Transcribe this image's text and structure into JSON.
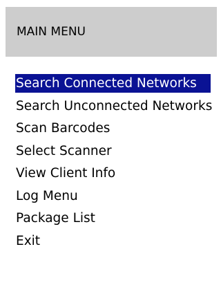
{
  "header": {
    "title": "MAIN MENU"
  },
  "menu": {
    "selected_index": 0,
    "items": [
      {
        "label": "Search Connected Networks"
      },
      {
        "label": "Search Unconnected Networks"
      },
      {
        "label": "Scan Barcodes"
      },
      {
        "label": "Select Scanner"
      },
      {
        "label": "View Client Info"
      },
      {
        "label": "Log Menu"
      },
      {
        "label": "Package List"
      },
      {
        "label": "Exit"
      }
    ]
  },
  "colors": {
    "header_bg": "#cdcdcd",
    "selection_bg": "#0a1294",
    "selection_text": "#ffffff",
    "text": "#000000"
  }
}
